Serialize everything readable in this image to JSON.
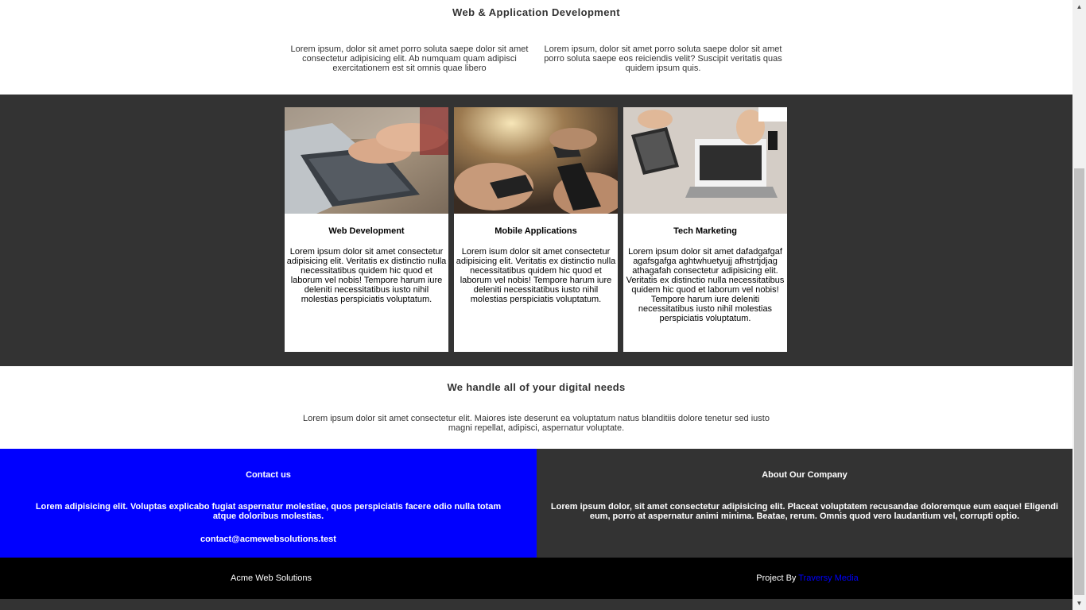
{
  "intro": {
    "title": "Web & Application Development",
    "col1": "Lorem ipsum, dolor sit amet porro soluta saepe dolor sit amet consectetur adipisicing elit. Ab numquam quam adipisci exercitationem est sit omnis quae libero",
    "col2": "Lorem ipsum, dolor sit amet porro soluta saepe dolor sit amet porro soluta saepe eos reiciendis velit? Suscipit veritatis quas quidem ipsum quis."
  },
  "cards": [
    {
      "title": "Web Development",
      "text": "Lorem ipsum dolor sit amet consectetur adipisicing elit. Veritatis ex distinctio nulla necessitatibus quidem hic quod et laborum vel nobis! Tempore harum iure deleniti necessitatibus iusto nihil molestias perspiciatis voluptatum."
    },
    {
      "title": "Mobile Applications",
      "text": "Lorem isum dolor sit amet consectetur adipisicing elit. Veritatis ex distinctio nulla necessitatibus quidem hic quod et laborum vel nobis! Tempore harum iure deleniti necessitatibus iusto nihil molestias perspiciatis voluptatum."
    },
    {
      "title": "Tech Marketing",
      "text": "Lorem ipsum dolor sit amet dafadgafgaf agafsgafga aghtwhuetyujj afhstrtjdjag athagafah consectetur adipisicing elit. Veritatis ex distinctio nulla necessitatibus quidem hic quod et laborum vel nobis! Tempore harum iure deleniti necessitatibus iusto nihil molestias perspiciatis voluptatum."
    }
  ],
  "needs": {
    "title": "We handle all of your digital needs",
    "text": "Lorem ipsum dolor sit amet consectetur elit. Maiores iste deserunt ea voluptatum natus blanditiis dolore tenetur sed iusto magni repellat, adipisci, aspernatur voluptate."
  },
  "contact": {
    "title": "Contact us",
    "text": "Lorem adipisicing elit. Voluptas explicabo fugiat aspernatur molestiae, quos perspiciatis facere odio nulla totam atque doloribus molestias.",
    "email": "contact@acmewebsolutions.test"
  },
  "about": {
    "title": "About Our Company",
    "text": "Lorem ipsum dolor, sit amet consectetur adipisicing elit. Placeat voluptatem recusandae doloremque eum eaque! Eligendi eum, porro at aspernatur animi minima. Beatae, rerum. Omnis quod vero laudantium vel, corrupti optio."
  },
  "footer": {
    "brand": "Acme Web Solutions",
    "credit_prefix": "Project By",
    "credit_link": "Traversy Media"
  },
  "colors": {
    "contact_bg": "#0000ff",
    "dark_bg": "#333333",
    "footer_bg": "#000000",
    "link": "#0000ff"
  }
}
